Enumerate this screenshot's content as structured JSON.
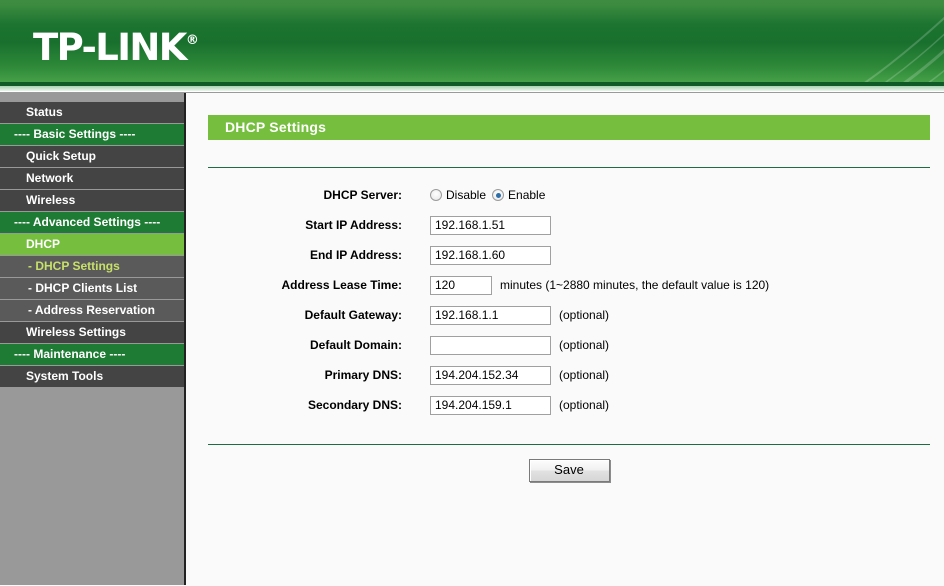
{
  "brand": {
    "name": "TP-LINK",
    "registered_mark": "®"
  },
  "sidebar": {
    "items": [
      {
        "label": "Status",
        "type": "normal"
      },
      {
        "label": "---- Basic Settings ----",
        "type": "section"
      },
      {
        "label": "Quick Setup",
        "type": "normal"
      },
      {
        "label": "Network",
        "type": "normal"
      },
      {
        "label": "Wireless",
        "type": "normal"
      },
      {
        "label": "---- Advanced Settings ----",
        "type": "section"
      },
      {
        "label": "DHCP",
        "type": "active-parent"
      },
      {
        "label": "- DHCP Settings",
        "type": "sub-current"
      },
      {
        "label": "- DHCP Clients List",
        "type": "sub"
      },
      {
        "label": "- Address Reservation",
        "type": "sub"
      },
      {
        "label": "Wireless Settings",
        "type": "normal"
      },
      {
        "label": "---- Maintenance ----",
        "type": "section"
      },
      {
        "label": "System Tools",
        "type": "normal"
      }
    ]
  },
  "panel": {
    "title": "DHCP Settings"
  },
  "form": {
    "dhcp_server": {
      "label": "DHCP Server:",
      "options": [
        {
          "label": "Disable",
          "selected": false
        },
        {
          "label": "Enable",
          "selected": true
        }
      ]
    },
    "start_ip": {
      "label": "Start IP Address:",
      "value": "192.168.1.51",
      "placeholder": ""
    },
    "end_ip": {
      "label": "End IP Address:",
      "value": "192.168.1.60",
      "placeholder": ""
    },
    "lease_time": {
      "label": "Address Lease Time:",
      "value": "120",
      "placeholder": "",
      "hint": "minutes (1~2880 minutes, the default value is 120)"
    },
    "default_gateway": {
      "label": "Default Gateway:",
      "value": "192.168.1.1",
      "placeholder": "",
      "hint": "(optional)"
    },
    "default_domain": {
      "label": "Default Domain:",
      "value": "",
      "placeholder": "",
      "hint": "(optional)"
    },
    "primary_dns": {
      "label": "Primary DNS:",
      "value": "194.204.152.34",
      "placeholder": "",
      "hint": "(optional)"
    },
    "secondary_dns": {
      "label": "Secondary DNS:",
      "value": "194.204.159.1",
      "placeholder": "",
      "hint": "(optional)"
    },
    "save_label": "Save"
  },
  "colors": {
    "header_green": "#1c7430",
    "accent_lime": "#76bf3e",
    "section_green": "#1d7b33",
    "menu_gray": "#444444",
    "sidebar_bg": "#999999",
    "rule_green": "#1f6b43",
    "sub_current_text": "#c7e06a",
    "radio_dot": "#2b6ea8"
  }
}
